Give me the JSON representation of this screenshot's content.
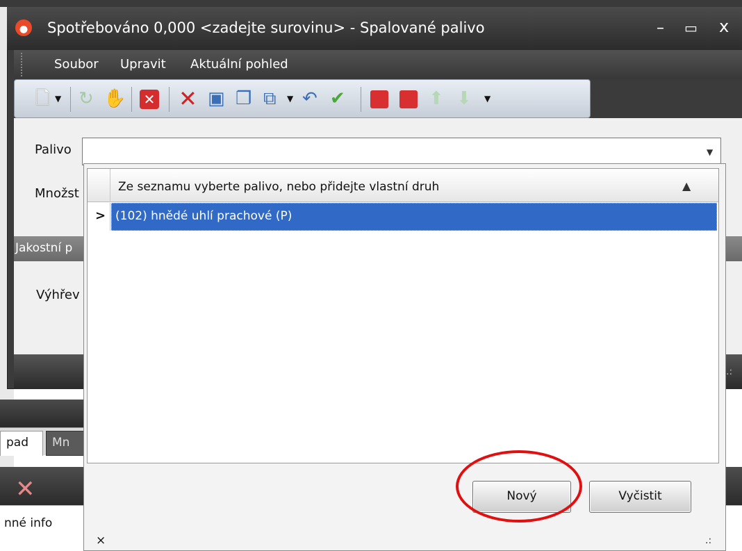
{
  "window": {
    "title": "Spotřebováno 0,000  <zadejte surovinu> - Spalované palivo",
    "controls": {
      "minimize": "–",
      "maximize": "▭",
      "close": "x"
    }
  },
  "menu": {
    "items": [
      "Soubor",
      "Upravit",
      "Aktuální pohled"
    ]
  },
  "toolbar": {
    "icons": [
      "new-document",
      "refresh",
      "hand",
      "cancel-red",
      "delete",
      "save",
      "copy",
      "paste",
      "undo",
      "check",
      "table-red",
      "export-red",
      "up",
      "down"
    ]
  },
  "form": {
    "palivo_label": "Palivo",
    "palivo_value": "",
    "mnozstvi_label": "Množst",
    "section_label": "Jakostní p",
    "vyhrev_label": "Výhřev"
  },
  "popup": {
    "column_header": "Ze seznamu vyberte palivo, nebo přidejte vlastní druh",
    "sort_indicator": "▲",
    "rows": [
      {
        "text": "(102) hnědé uhlí prachové (P)",
        "selected": true
      }
    ],
    "row_indicator": ">",
    "new_button": "Nový",
    "clear_button": "Vyčistit",
    "close_symbol": "×",
    "highlight_color": "#e01010"
  },
  "background": {
    "tab1": "pad",
    "tab2": "Mn",
    "info_text": "nné info"
  },
  "colors": {
    "selection": "#3169c6",
    "title_bar": "#3a3a3a"
  }
}
